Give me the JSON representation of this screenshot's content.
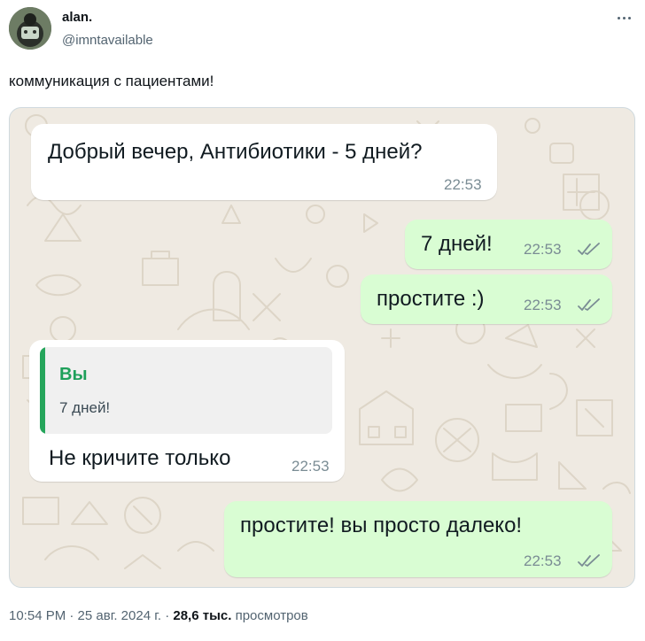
{
  "author": {
    "name": "alan.",
    "handle": "@imntavailable"
  },
  "tweet": {
    "text": "коммуникация с пациентами!"
  },
  "chat": {
    "messages": [
      {
        "direction": "incoming",
        "text": "Добрый вечер, Антибиотики - 5 дней?",
        "time": "22:53"
      },
      {
        "direction": "outgoing",
        "text": "7 дней!",
        "time": "22:53",
        "status": "read-ticks-icon"
      },
      {
        "direction": "outgoing",
        "text": "простите :)",
        "time": "22:53",
        "status": "read-ticks-icon"
      },
      {
        "direction": "incoming",
        "quote": {
          "author": "Вы",
          "text": "7 дней!"
        },
        "text": "Не кричите только",
        "time": "22:53"
      },
      {
        "direction": "outgoing",
        "text": "простите! вы просто далеко!",
        "time": "22:53",
        "status": "read-ticks-icon"
      }
    ],
    "colors": {
      "wallpaper": "#efeae2",
      "incoming_bubble": "#ffffff",
      "outgoing_bubble": "#d9fdd3",
      "quote_accent": "#25a55b"
    }
  },
  "meta": {
    "time_date": "10:54 PM · 25 авг. 2024 г.",
    "separator": "·",
    "views_count": "28,6 тыс.",
    "views_label": "просмотров"
  }
}
